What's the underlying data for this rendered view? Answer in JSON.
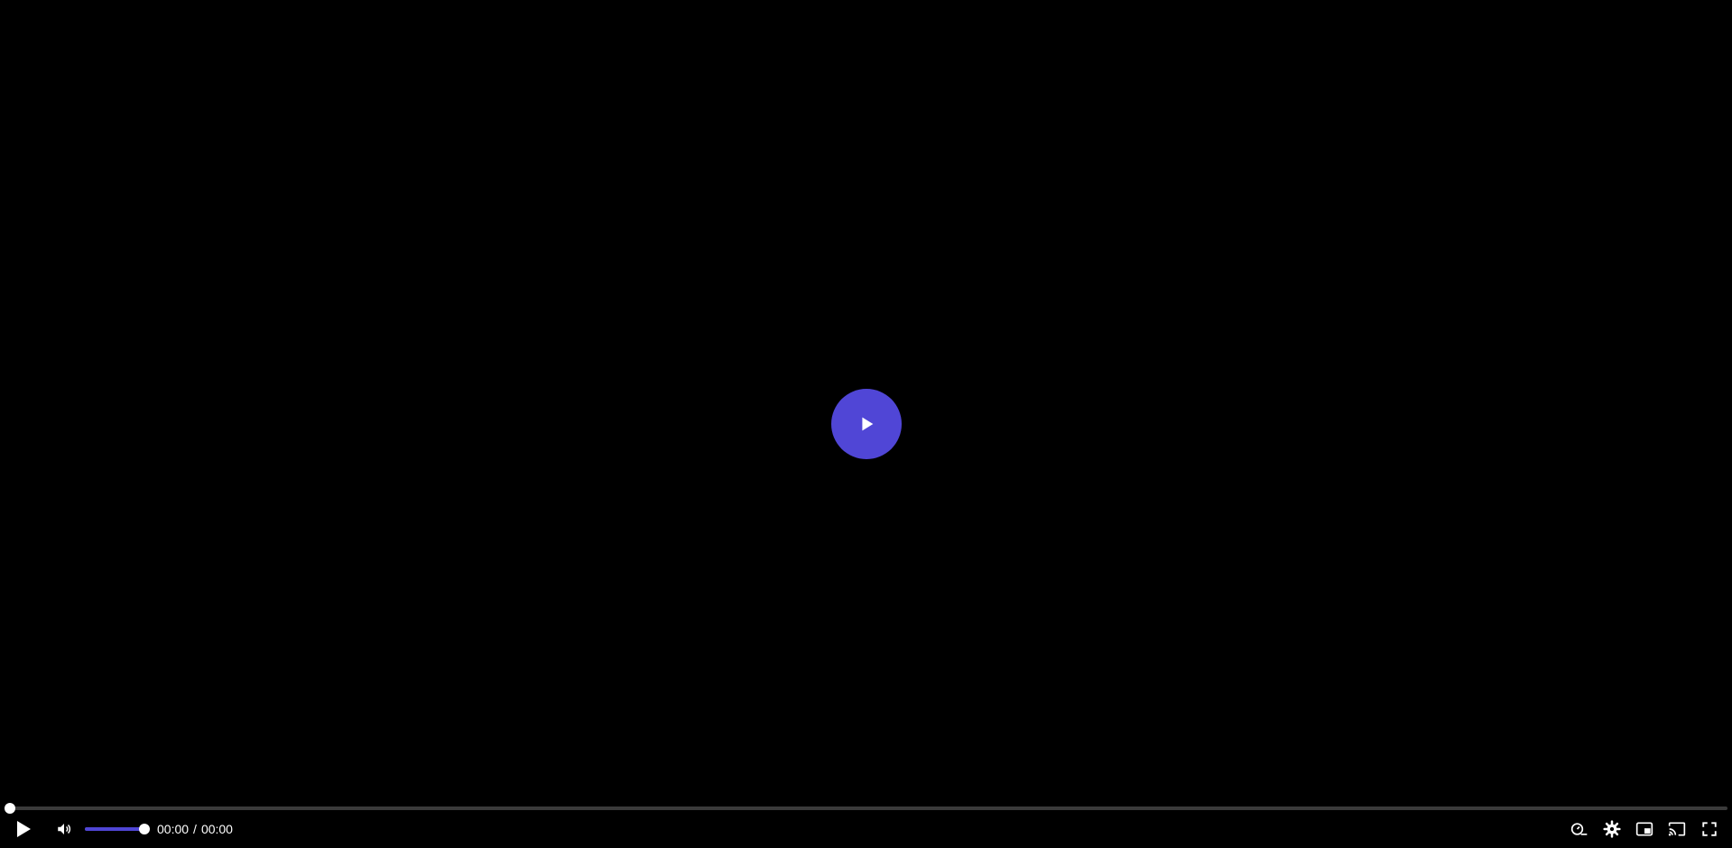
{
  "video": {
    "title": ""
  },
  "playback": {
    "current_time": "00:00",
    "separator": "/",
    "duration": "00:00",
    "progress": 0,
    "volume": 1
  },
  "colors": {
    "background": "#000000",
    "accent": "#5046d6",
    "track": "#3a3a3a",
    "icon": "#ffffff"
  },
  "icons": {
    "big_play": "play-icon",
    "play": "play-icon",
    "mute": "volume-icon",
    "speed": "playback-speed-icon",
    "settings": "gear-icon",
    "pip": "picture-in-picture-icon",
    "cast": "cast-icon",
    "fullscreen": "fullscreen-icon"
  }
}
